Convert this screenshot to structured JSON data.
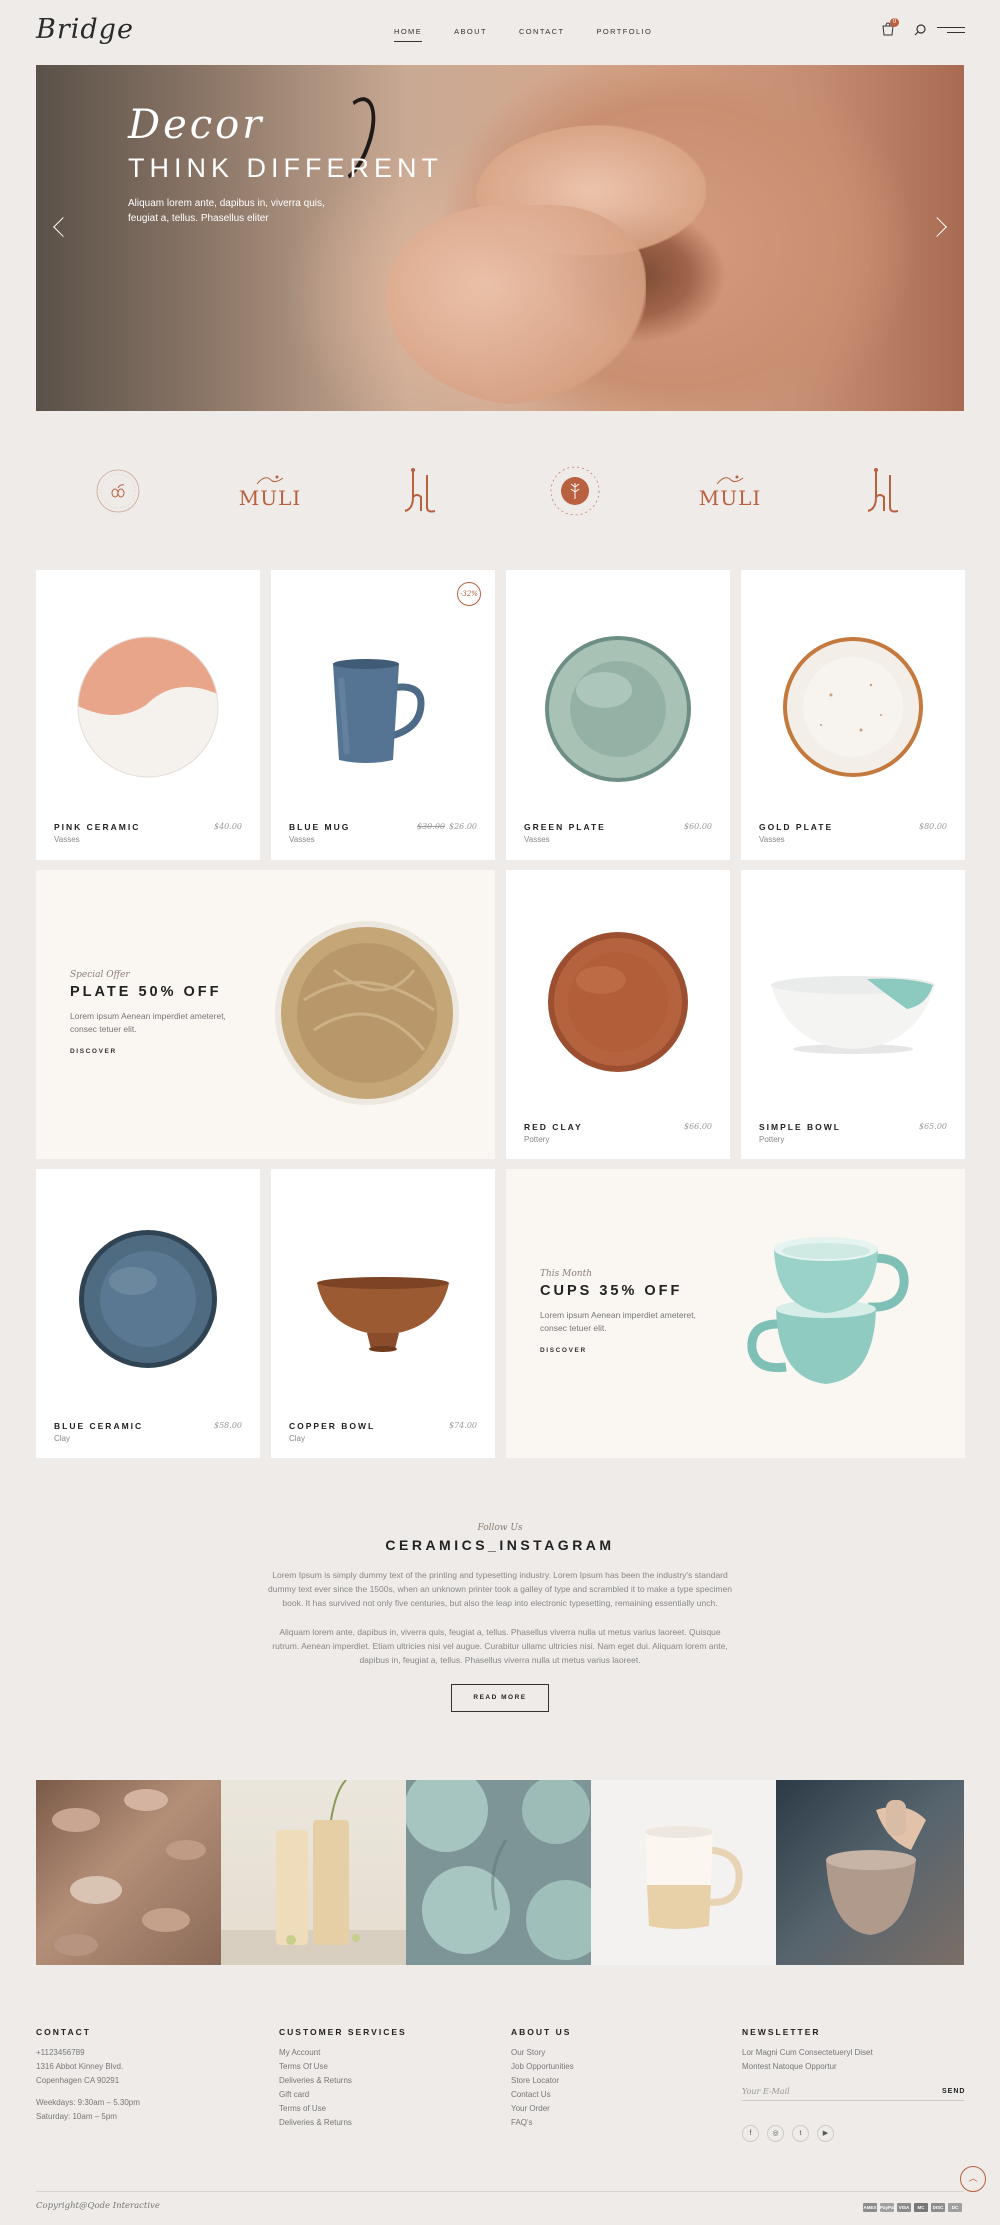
{
  "header": {
    "logo": "Bridge",
    "nav": [
      "HOME",
      "ABOUT",
      "CONTACT",
      "PORTFOLIO"
    ],
    "cart_count": "0"
  },
  "hero": {
    "script": "Decor",
    "title": "THINK DIFFERENT",
    "text": "Aliquam lorem ante, dapibus in, viverra quis, feugiat a, tellus. Phasellus eliter"
  },
  "brands": {
    "muli": "MULI",
    "stamp_top": "LINDA CLOUD",
    "stamp_bottom": "PHOTOGRAPHER",
    "stamp_left": "EST",
    "stamp_right": "2019"
  },
  "products": [
    {
      "name": "PINK CERAMIC",
      "category": "Vasses",
      "price": "$40.00"
    },
    {
      "name": "BLUE MUG",
      "category": "Vasses",
      "old_price": "$30.00",
      "price": "$26.00",
      "badge": "-32%"
    },
    {
      "name": "GREEN PLATE",
      "category": "Vasses",
      "price": "$60.00"
    },
    {
      "name": "GOLD PLATE",
      "category": "Vasses",
      "price": "$80.00"
    },
    {
      "name": "RED CLAY",
      "category": "Pottery",
      "price": "$66.00"
    },
    {
      "name": "SIMPLE BOWL",
      "category": "Pottery",
      "price": "$65.00"
    },
    {
      "name": "BLUE CERAMIC",
      "category": "Clay",
      "price": "$58.00"
    },
    {
      "name": "COPPER BOWL",
      "category": "Clay",
      "price": "$74.00"
    }
  ],
  "offers": [
    {
      "small": "Special Offer",
      "title": "PLATE 50% OFF",
      "text": "Lorem ipsum Aenean imperdiet ameteret, consec tetuer elit.",
      "link": "DISCOVER"
    },
    {
      "small": "This Month",
      "title": "CUPS 35% OFF",
      "text": "Lorem ipsum Aenean imperdiet ameteret, consec tetuer elit.",
      "link": "DISCOVER"
    }
  ],
  "instagram": {
    "small": "Follow Us",
    "title": "CERAMICS_INSTAGRAM",
    "para1": "Lorem Ipsum is simply dummy text of the printing and typesetting industry. Lorem Ipsum has been the industry's standard dummy text ever since the 1500s, when an unknown printer took a galley of type and scrambled it to make a type specimen book. It has survived not only five centuries, but also the leap into electronic typesetting, remaining essentially unch.",
    "para2": "Aliquam lorem ante, dapibus in, viverra quis, feugiat a, tellus. Phasellus viverra nulla ut metus varius laoreet. Quisque rutrum. Aenean imperdiet. Etiam ultricies nisi vel augue. Curabitur ullamc ultricies nisi. Nam eget dui. Aliquam lorem ante, dapibus in, feugiat a, tellus. Phasellus viverra nulla ut metus varius laoreet.",
    "button": "READ MORE"
  },
  "footer": {
    "contact": {
      "title": "CONTACT",
      "lines": [
        "+1123456789",
        "1316 Abbot Kinney Blvd.",
        "Copenhagen CA 90291",
        "",
        "Weekdays: 9:30am – 5.30pm",
        "Saturday: 10am – 5pm"
      ]
    },
    "services": {
      "title": "CUSTOMER SERVICES",
      "lines": [
        "My Account",
        "Terms Of Use",
        "Deliveries & Returns",
        "Gift card",
        "Terms of Use",
        "Deliveries & Returns"
      ]
    },
    "about": {
      "title": "ABOUT US",
      "lines": [
        "Our Story",
        "Job Opportunities",
        "Store Locator",
        "Contact Us",
        "Your Order",
        "FAQ's"
      ]
    },
    "newsletter": {
      "title": "NEWSLETTER",
      "lines": [
        "Lor Magni Cum Consectetueryl Diset",
        "Montest Natoque Opportur"
      ],
      "placeholder": "Your E-Mail",
      "send": "SEND"
    },
    "social": [
      "f",
      "◎",
      "t",
      "▶"
    ],
    "copyright": "Copyright@Qode Interactive",
    "payments": [
      "AMEX",
      "PayPal",
      "VISA",
      "MC",
      "DISC",
      "DC"
    ]
  },
  "colors": {
    "accent": "#b8603f",
    "background": "#efebe8"
  }
}
